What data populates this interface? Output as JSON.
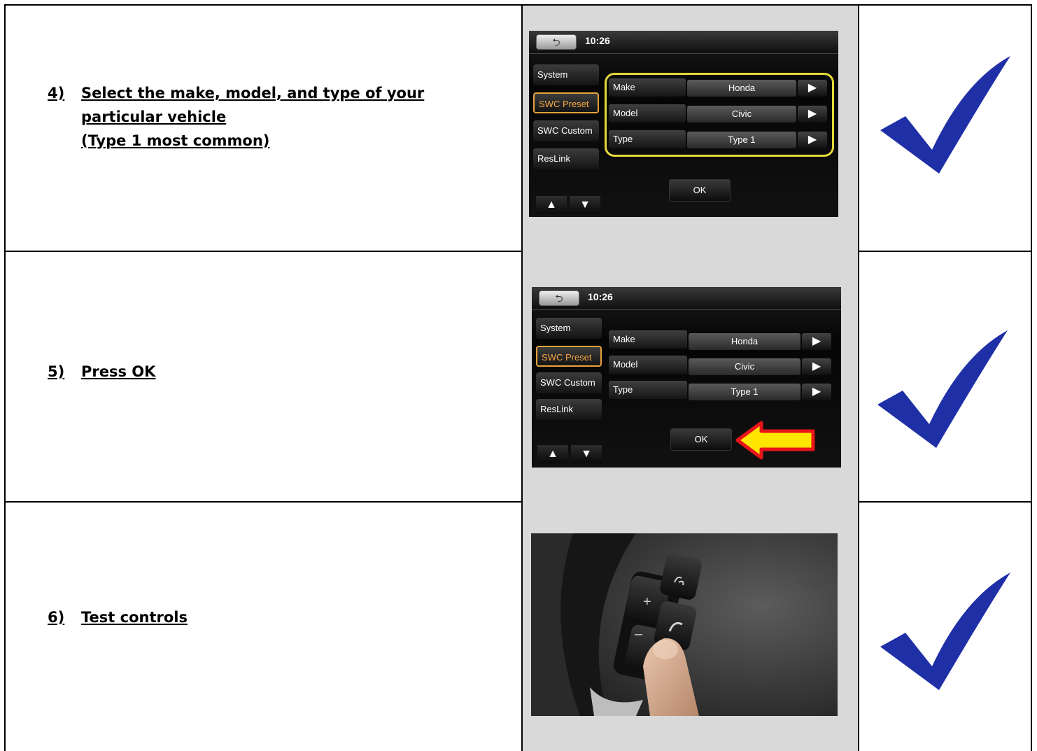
{
  "steps": [
    {
      "num": "4)",
      "text": "Select the make, model, and type of your",
      "line2": "particular vehicle",
      "line3": "(Type 1 most common)"
    },
    {
      "num": "5)",
      "text": "Press OK"
    },
    {
      "num": "6)",
      "text": "Test controls"
    }
  ],
  "screen": {
    "back_icon": "back-arrow-icon",
    "time": "10:26",
    "menu": [
      "System",
      "SWC Preset",
      "SWC Custom",
      "ResLink"
    ],
    "fields": [
      {
        "label": "Make",
        "value": "Honda"
      },
      {
        "label": "Model",
        "value": "Civic"
      },
      {
        "label": "Type",
        "value": "Type 1"
      }
    ],
    "ok": "OK",
    "arrow_glyph": "▶",
    "up_glyph": "▲",
    "down_glyph": "▼"
  },
  "wheel_buttons": {
    "plus": "+",
    "minus": "–"
  },
  "colors": {
    "check": "#1f2fa6",
    "highlight": "#e4d93a",
    "selected": "#f4a640",
    "arrow_fill": "#ffe600",
    "arrow_stroke": "#e8141a"
  }
}
